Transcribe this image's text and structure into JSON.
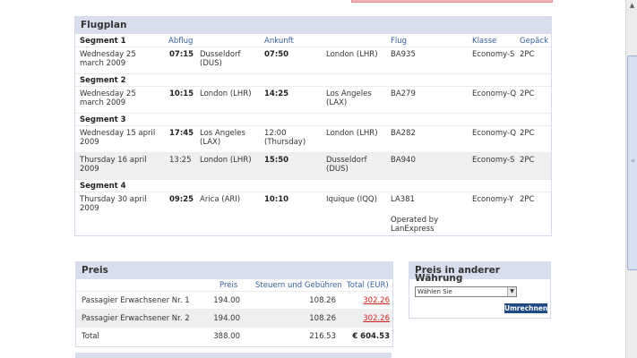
{
  "flightplan": {
    "title": "Flugplan",
    "columns": {
      "segment": "Segment 1",
      "departure": "Abflug",
      "arrival": "Ankunft",
      "flight": "Flug",
      "class": "Klasse",
      "baggage": "Gepäck"
    },
    "segments": [
      "Segment 2",
      "Segment 3",
      "Segment 4"
    ],
    "rows": [
      {
        "date": "Wednesday 25 march 2009",
        "dep_time": "07:15",
        "dep_place": "Dusseldorf (DUS)",
        "arr_time": "07:50",
        "arr_place": "London (LHR)",
        "flight": "BA935",
        "class": "Economy-S",
        "baggage": "2PC"
      },
      {
        "date": "Wednesday 25 march 2009",
        "dep_time": "10:15",
        "dep_place": "London (LHR)",
        "arr_time": "14:25",
        "arr_place": "Los Angeles (LAX)",
        "flight": "BA279",
        "class": "Economy-Q",
        "baggage": "2PC"
      },
      {
        "date": "Wednesday 15 april 2009",
        "dep_time": "17:45",
        "dep_place": "Los Angeles (LAX)",
        "arr_time": "12:00 (Thursday)",
        "arr_place": "London (LHR)",
        "flight": "BA282",
        "class": "Economy-Q",
        "baggage": "2PC"
      },
      {
        "date": "Thursday 16 april 2009",
        "dep_time": "13:25",
        "dep_place": "London (LHR)",
        "arr_time": "15:50",
        "arr_place": "Dusseldorf (DUS)",
        "flight": "BA940",
        "class": "Economy-S",
        "baggage": "2PC"
      },
      {
        "date": "Thursday 30 april 2009",
        "dep_time": "09:25",
        "dep_place": "Arica (ARI)",
        "arr_time": "10:10",
        "arr_place": "Iquique (IQQ)",
        "flight": "LA381",
        "operated": "Operated by LanExpress",
        "class": "Economy-Y",
        "baggage": "2PC"
      }
    ]
  },
  "price": {
    "title": "Preis",
    "columns": {
      "price": "Preis",
      "taxes": "Steuern und Gebühren",
      "total": "Total (EUR)"
    },
    "rows": [
      {
        "label": "Passagier Erwachsener Nr. 1",
        "price": "194.00",
        "taxes": "108.26",
        "total": "302.26"
      },
      {
        "label": "Passagier Erwachsener Nr. 2",
        "price": "194.00",
        "taxes": "108.26",
        "total": "302.26"
      }
    ],
    "total_row": {
      "label": "Total",
      "price": "388.00",
      "taxes": "216.53",
      "total": "€ 604.53"
    }
  },
  "currency": {
    "title": "Preis in anderer Währung",
    "select_value": "Wählen Sie",
    "button": "Umrechnen"
  },
  "colors": {
    "header_bg": "#d8deee",
    "link_red": "#cc2222",
    "button_bg": "#1f4a86",
    "column_blue": "#36609a"
  }
}
